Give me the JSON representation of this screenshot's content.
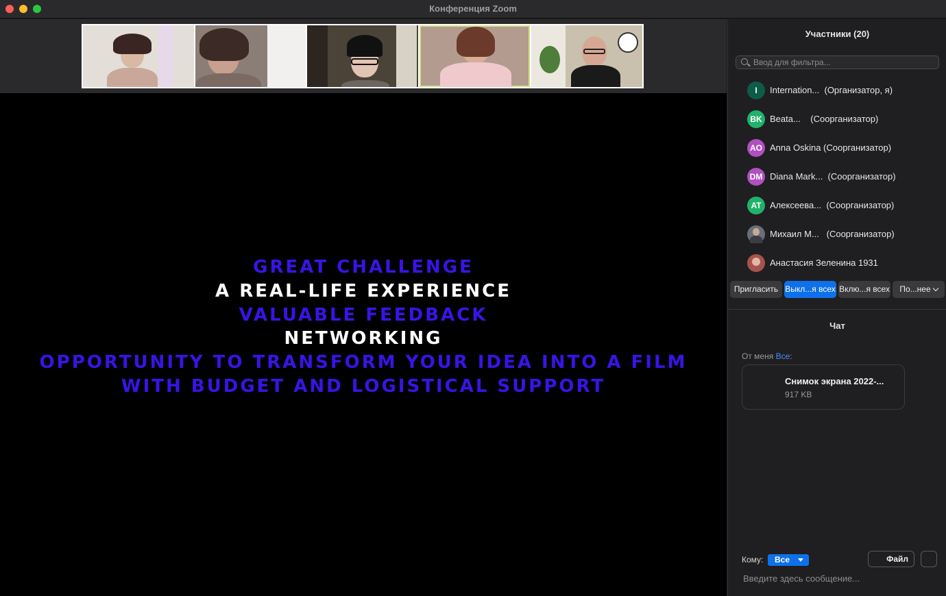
{
  "window": {
    "title": "Конференция Zoom"
  },
  "gallery": {
    "tiles": [
      {
        "name": "participant-video-1",
        "bg": "#d9d4cf"
      },
      {
        "name": "participant-video-2",
        "bg": "#8b7e76"
      },
      {
        "name": "participant-video-3",
        "bg": "#4b4238"
      },
      {
        "name": "participant-video-4",
        "bg": "#b39b8f"
      },
      {
        "name": "participant-video-5",
        "bg": "#c9c0ad"
      }
    ]
  },
  "slide": {
    "lines": [
      {
        "text": "GREAT CHALLENGE",
        "color": "blue"
      },
      {
        "text": "A REAL-LIFE EXPERIENCE",
        "color": "white"
      },
      {
        "text": "VALUABLE FEEDBACK",
        "color": "blue"
      },
      {
        "text": "NETWORKING",
        "color": "white"
      },
      {
        "text": "OPPORTUNITY TO TRANSFORM YOUR IDEA INTO A FILM",
        "color": "blue"
      },
      {
        "text": "WITH BUDGET AND LOGISTICAL SUPPORT",
        "color": "blue"
      }
    ]
  },
  "participants": {
    "title": "Участники (20)",
    "filter_placeholder": "Ввод для фильтра...",
    "list": [
      {
        "initials": "I",
        "color": "#0d5c4a",
        "name": "Internation...  (Организатор, я)"
      },
      {
        "initials": "BK",
        "color": "#20b26b",
        "name": "Beata...    (Соорганизатор)"
      },
      {
        "initials": "AO",
        "color": "#b050c0",
        "name": "Anna Oskina (Соорганизатор)"
      },
      {
        "initials": "DM",
        "color": "#b050c0",
        "name": "Diana Mark...  (Соорганизатор)"
      },
      {
        "initials": "AT",
        "color": "#20b26b",
        "name": "Алексеева...  (Соорганизатор)"
      },
      {
        "initials": "",
        "color": "#6a6e78",
        "name": "Михаил М...   (Соорганизатор)"
      },
      {
        "initials": "",
        "color": "#a8524e",
        "name": "Анастасия Зеленина 1931"
      }
    ],
    "buttons": {
      "invite": "Пригласить",
      "mute_all": "Выкл...я всех",
      "unmute_all": "Вклю...я всех",
      "more": "По...нее"
    }
  },
  "chat": {
    "title": "Чат",
    "from_label": "От меня",
    "from_to": "Все",
    "from_colon": ":",
    "file": {
      "name": "Снимок экрана 2022-...",
      "size": "917 KB"
    },
    "to_label": "Кому:",
    "to_value": "Все",
    "file_button": "Файл",
    "input_placeholder": "Введите здесь сообщение..."
  }
}
